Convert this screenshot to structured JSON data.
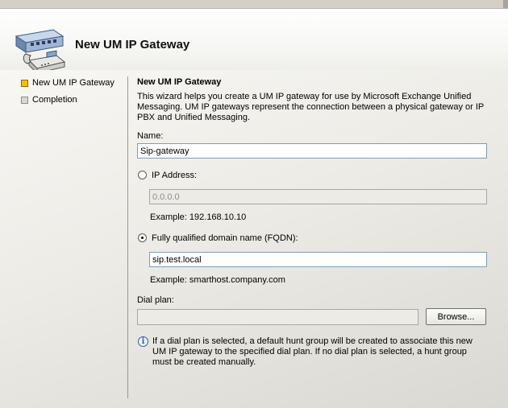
{
  "header": {
    "title": "New UM IP Gateway"
  },
  "sidebar": {
    "items": [
      {
        "label": "New UM IP Gateway",
        "state": "current"
      },
      {
        "label": "Completion",
        "state": "pending"
      }
    ]
  },
  "main": {
    "section_title": "New UM IP Gateway",
    "description": "This wizard helps you create a UM IP gateway for use by Microsoft Exchange Unified Messaging. UM IP gateways represent the connection between a physical gateway or IP PBX and Unified Messaging.",
    "name": {
      "label": "Name:",
      "value": "Sip-gateway"
    },
    "ip_address": {
      "label": "IP Address:",
      "value": "0.0.0.0",
      "example": "Example: 192.168.10.10",
      "selected": false
    },
    "fqdn": {
      "label": "Fully qualified domain name (FQDN):",
      "value": "sip.test.local",
      "example": "Example: smarthost.company.com",
      "selected": true
    },
    "dial_plan": {
      "label": "Dial plan:",
      "value": "",
      "browse_label": "Browse..."
    },
    "info": {
      "icon": "info-icon",
      "text": "If a dial plan is selected, a default hunt group will be created to associate this new UM IP gateway to the specified dial plan. If no dial plan is selected, a hunt group must be created manually."
    }
  },
  "colors": {
    "current_step": "#f2c200",
    "textbox_border": "#7f9db9",
    "info_blue": "#2f5fa8"
  }
}
